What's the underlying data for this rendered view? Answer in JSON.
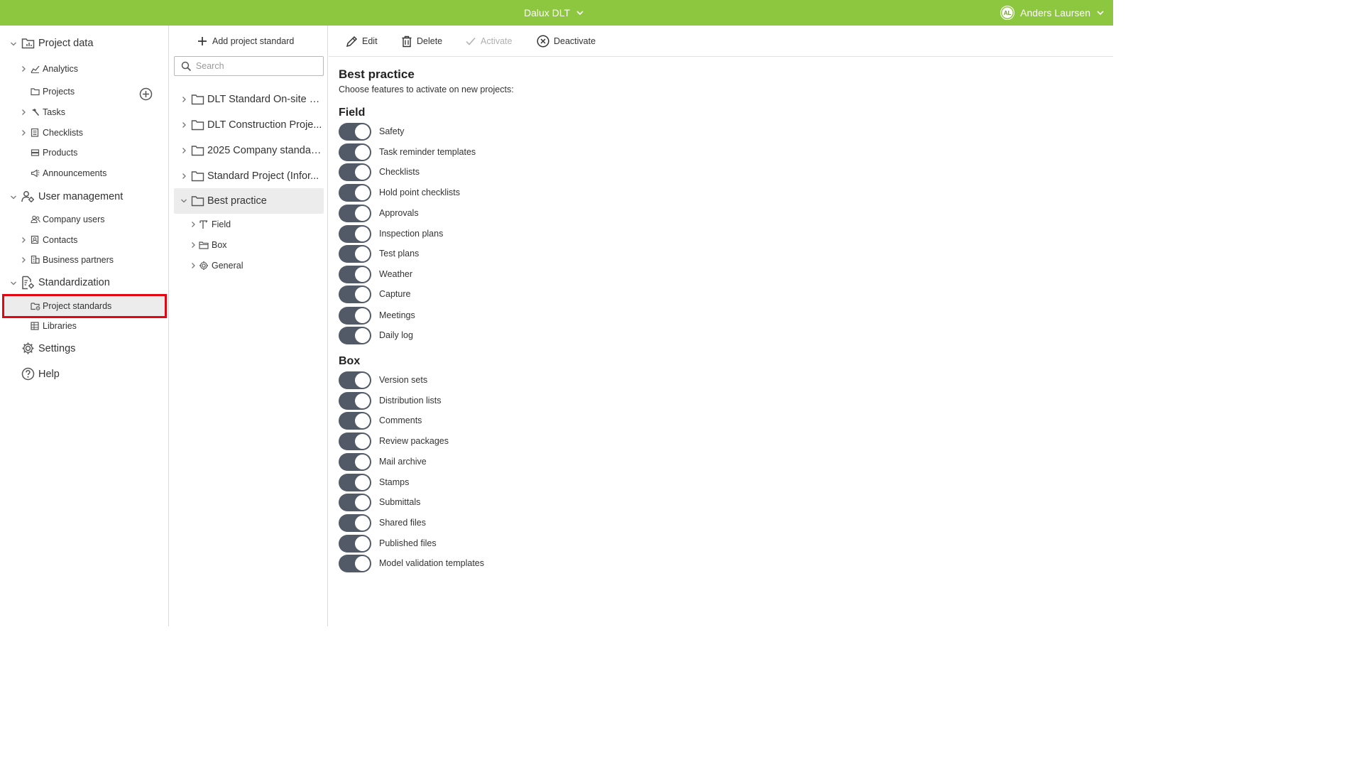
{
  "topbar": {
    "app_name": "Dalux DLT",
    "user_initials": "AL",
    "user_name": "Anders Laursen"
  },
  "leftnav": {
    "project_data": "Project data",
    "analytics": "Analytics",
    "projects": "Projects",
    "tasks": "Tasks",
    "checklists": "Checklists",
    "products": "Products",
    "announcements": "Announcements",
    "user_management": "User management",
    "company_users": "Company users",
    "contacts": "Contacts",
    "business_partners": "Business partners",
    "standardization": "Standardization",
    "project_standards": "Project standards",
    "libraries": "Libraries",
    "settings": "Settings",
    "help": "Help"
  },
  "midpanel": {
    "add_label": "Add project standard",
    "search_placeholder": "Search",
    "standards": [
      "DLT Standard On-site m...",
      "DLT Construction Proje...",
      "2025 Company standar...",
      "Standard Project (Infor...",
      "Best practice"
    ],
    "children": [
      "Field",
      "Box",
      "General"
    ]
  },
  "toolbar": {
    "edit": "Edit",
    "delete": "Delete",
    "activate": "Activate",
    "deactivate": "Deactivate"
  },
  "content": {
    "title": "Best practice",
    "subtitle": "Choose features to activate on new projects:",
    "field_title": "Field",
    "field_features": [
      "Safety",
      "Task reminder templates",
      "Checklists",
      "Hold point checklists",
      "Approvals",
      "Inspection plans",
      "Test plans",
      "Weather",
      "Capture",
      "Meetings",
      "Daily log"
    ],
    "box_title": "Box",
    "box_features": [
      "Version sets",
      "Distribution lists",
      "Comments",
      "Review packages",
      "Mail archive",
      "Stamps",
      "Submittals",
      "Shared files",
      "Published files",
      "Model validation templates"
    ]
  },
  "colors": {
    "topbar": "#8dc63f",
    "toggle_on": "#515a66",
    "selection_outline": "#e30613"
  }
}
